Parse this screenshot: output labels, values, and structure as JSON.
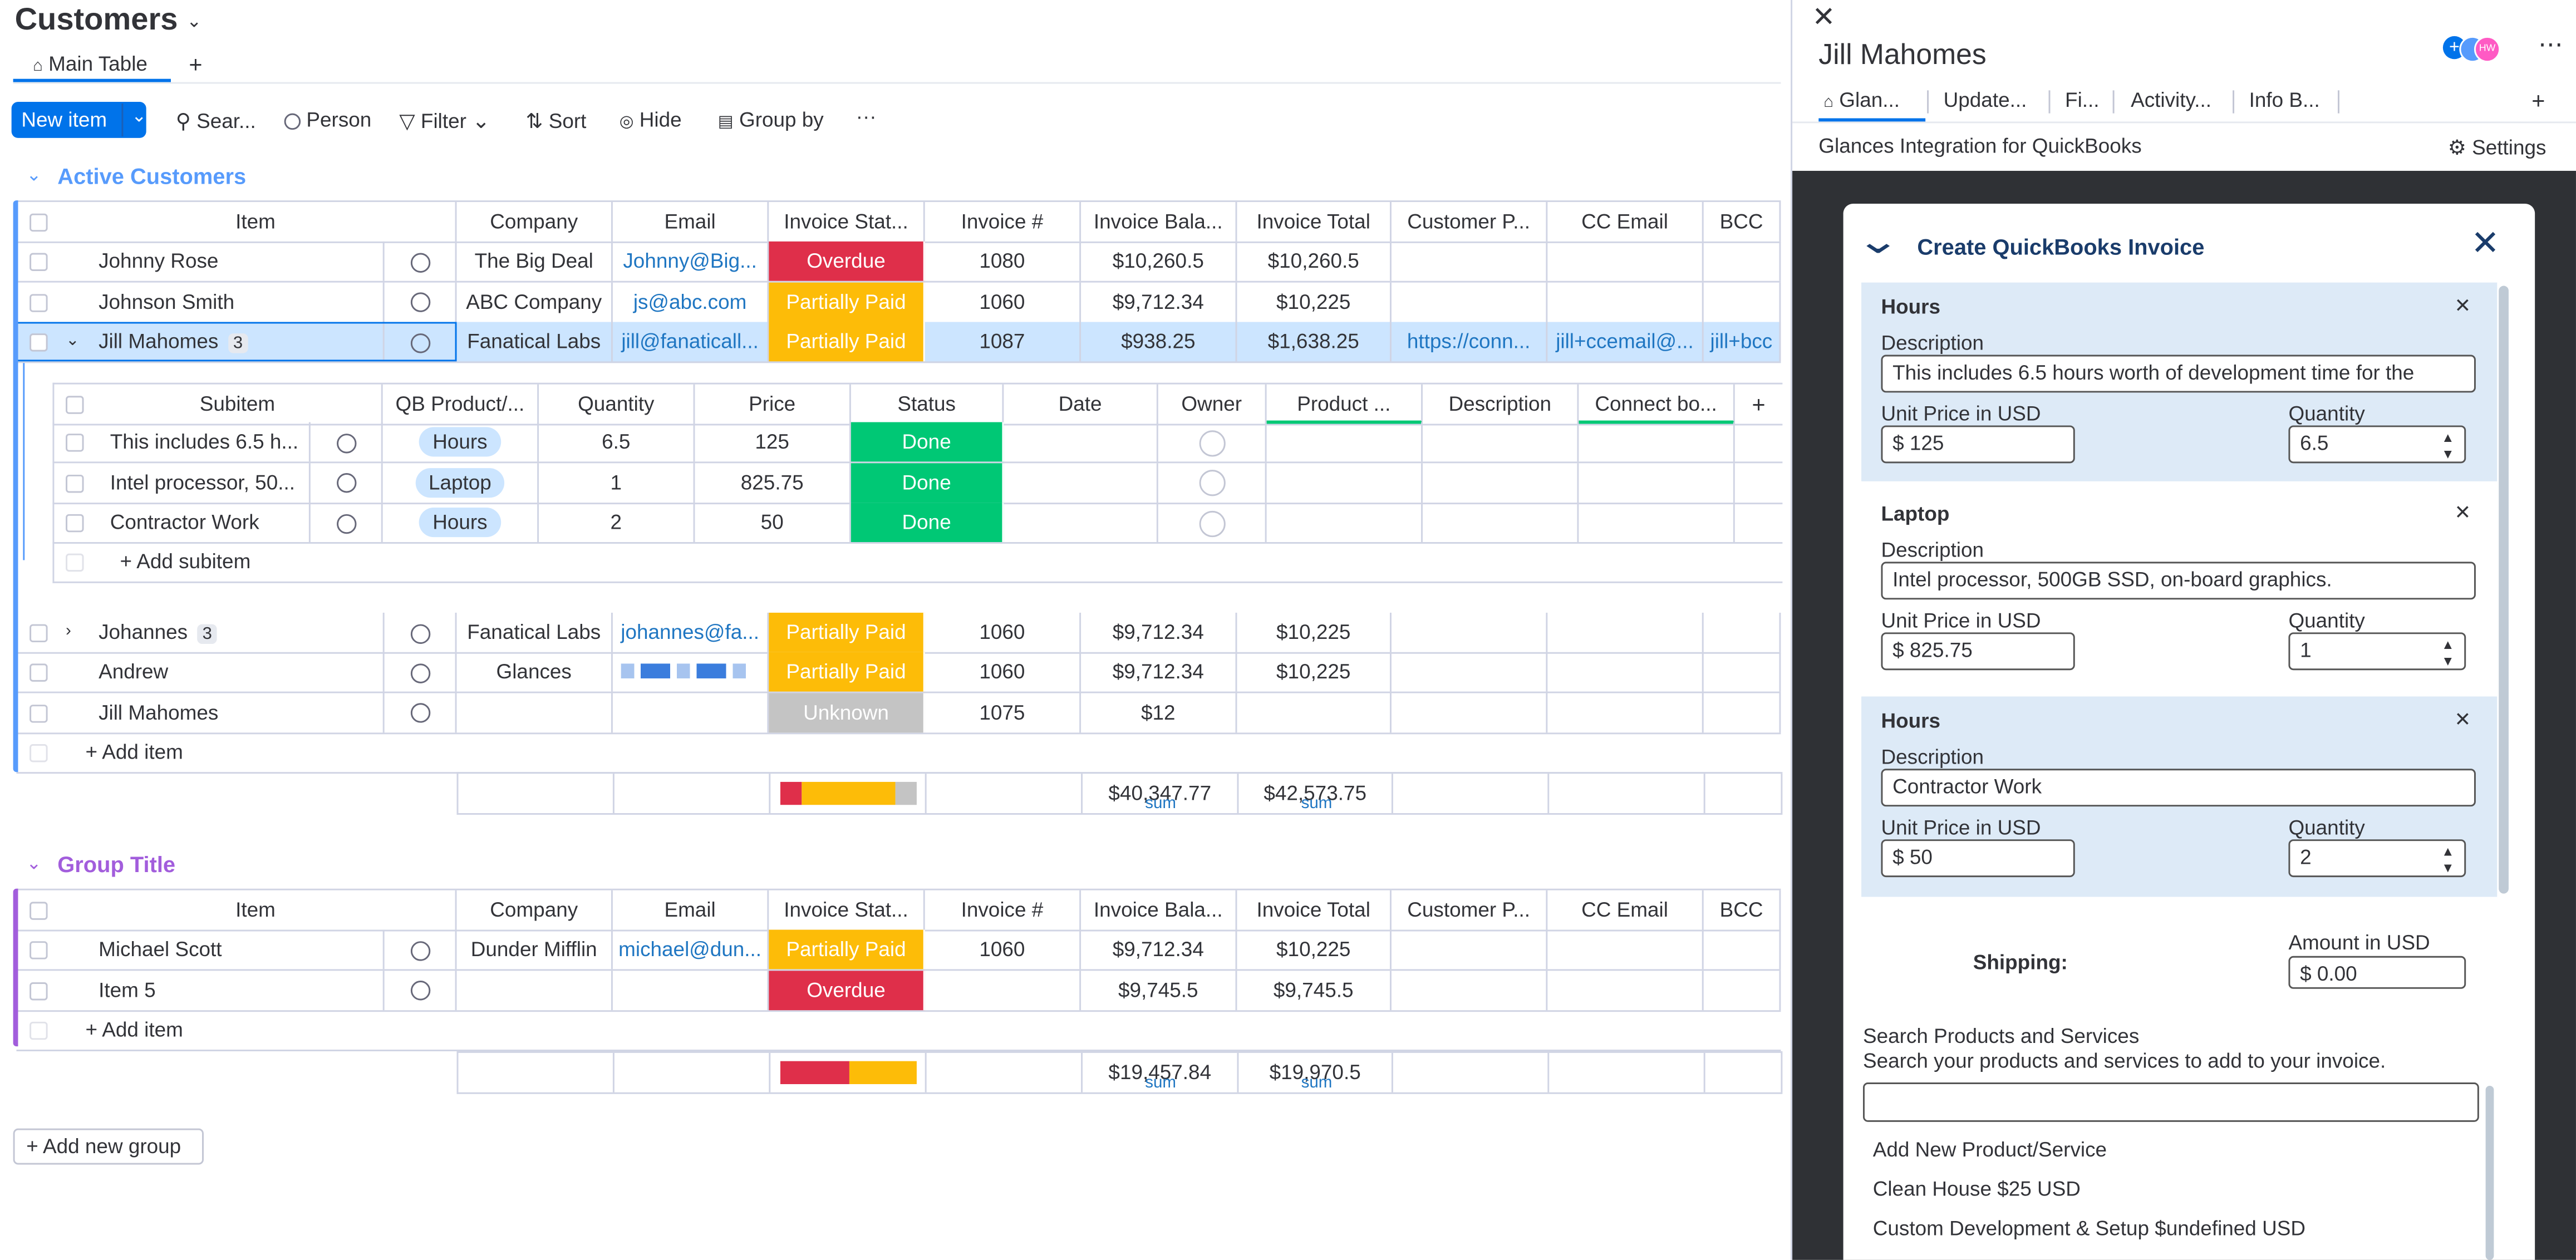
{
  "board": {
    "title": "Customers",
    "views": [
      "Main Table"
    ],
    "add_view": "+",
    "toolbar": {
      "new_item": "New item",
      "search": "Sear...",
      "person": "Person",
      "filter": "Filter",
      "sort": "Sort",
      "hide": "Hide",
      "group_by": "Group by",
      "more": "···"
    }
  },
  "columns": [
    "Item",
    "Company",
    "Email",
    "Invoice Stat...",
    "Invoice #",
    "Invoice Bala...",
    "Invoice Total",
    "Customer P...",
    "CC Email",
    "BCC"
  ],
  "groups": [
    {
      "title": "Active Customers",
      "color": "#579bfc",
      "rows": [
        {
          "item": "Johnny Rose",
          "company": "The Big Deal",
          "email": "Johnny@Big...",
          "status": "Overdue",
          "invoice": "1080",
          "balance": "$10,260.5",
          "total": "$10,260.5",
          "portal": "",
          "cc": "",
          "bcc": ""
        },
        {
          "item": "Johnson Smith",
          "company": "ABC Company",
          "email": "js@abc.com",
          "status": "Partially Paid",
          "invoice": "1060",
          "balance": "$9,712.34",
          "total": "$10,225",
          "portal": "",
          "cc": "",
          "bcc": ""
        },
        {
          "item": "Jill Mahomes",
          "sub_count": "3",
          "company": "Fanatical Labs",
          "email": "jill@fanaticall...",
          "status": "Partially Paid",
          "invoice": "1087",
          "balance": "$938.25",
          "total": "$1,638.25",
          "portal": "https://conn...",
          "cc": "jill+ccemail@...",
          "bcc": "jill+bcc"
        }
      ],
      "subitems": {
        "columns": [
          "Subitem",
          "QB Product/...",
          "Quantity",
          "Price",
          "Status",
          "Date",
          "Owner",
          "Product ...",
          "Description",
          "Connect bo..."
        ],
        "rows": [
          {
            "name": "This includes 6.5 h...",
            "product": "Hours",
            "qty": "6.5",
            "price": "125",
            "status": "Done"
          },
          {
            "name": "Intel processor, 50...",
            "product": "Laptop",
            "qty": "1",
            "price": "825.75",
            "status": "Done"
          },
          {
            "name": "Contractor Work",
            "product": "Hours",
            "qty": "2",
            "price": "50",
            "status": "Done"
          }
        ],
        "add_label": "+ Add subitem"
      },
      "rows_after": [
        {
          "item": "Johannes",
          "sub_count": "3",
          "company": "Fanatical Labs",
          "email": "johannes@fa...",
          "status": "Partially Paid",
          "invoice": "1060",
          "balance": "$9,712.34",
          "total": "$10,225"
        },
        {
          "item": "Andrew",
          "company": "Glances",
          "email": "",
          "status": "Partially Paid",
          "invoice": "1060",
          "balance": "$9,712.34",
          "total": "$10,225"
        },
        {
          "item": "Jill Mahomes",
          "company": "",
          "email": "",
          "status": "Unknown",
          "invoice": "1075",
          "balance": "$12",
          "total": ""
        }
      ],
      "add_item": "+ Add item",
      "summary": {
        "balance": "$40,347.77",
        "total": "$42,573.75",
        "sum_label": "sum",
        "status_bar": [
          {
            "color": "#df2f4a",
            "frac": 0.16
          },
          {
            "color": "#fdbc08",
            "frac": 0.68
          },
          {
            "color": "#c4c4c4",
            "frac": 0.16
          }
        ]
      }
    },
    {
      "title": "Group Title",
      "color": "#a25ddc",
      "rows": [
        {
          "item": "Michael Scott",
          "company": "Dunder Mifflin",
          "email": "michael@dun...",
          "status": "Partially Paid",
          "invoice": "1060",
          "balance": "$9,712.34",
          "total": "$10,225"
        },
        {
          "item": "Item 5",
          "company": "",
          "email": "",
          "status": "Overdue",
          "invoice": "",
          "balance": "$9,745.5",
          "total": "$9,745.5"
        }
      ],
      "add_item": "+ Add item",
      "summary": {
        "balance": "$19,457.84",
        "total": "$19,970.5",
        "sum_label": "sum",
        "status_bar": [
          {
            "color": "#df2f4a",
            "frac": 0.5
          },
          {
            "color": "#fdbc08",
            "frac": 0.5
          }
        ]
      }
    }
  ],
  "add_group": "Add new group",
  "panel": {
    "title": "Jill Mahomes",
    "avatar_initials": "HW",
    "tabs": [
      "Glan...",
      "Update...",
      "Fi...",
      "Activity...",
      "Info B..."
    ],
    "add_tab": "+",
    "integration_title": "Glances Integration for QuickBooks",
    "settings": "Settings",
    "form": {
      "title": "Create QuickBooks Invoice",
      "items": [
        {
          "name": "Hours",
          "description_label": "Description",
          "description": "This includes 6.5 hours worth of development time for the",
          "price_label": "Unit Price in USD",
          "price": "$ 125",
          "qty_label": "Quantity",
          "qty": "6.5"
        },
        {
          "name": "Laptop",
          "description_label": "Description",
          "description": "Intel processor, 500GB SSD, on-board graphics.",
          "price_label": "Unit Price in USD",
          "price": "$ 825.75",
          "qty_label": "Quantity",
          "qty": "1"
        },
        {
          "name": "Hours",
          "description_label": "Description",
          "description": "Contractor Work",
          "price_label": "Unit Price in USD",
          "price": "$ 50",
          "qty_label": "Quantity",
          "qty": "2"
        }
      ],
      "shipping_label": "Shipping:",
      "amount_label": "Amount in USD",
      "amount": "$ 0.00",
      "search_title": "Search Products and Services",
      "search_hint": "Search your products and services to add to your invoice.",
      "search_value": "",
      "products": [
        "Add New Product/Service",
        "Clean House $25 USD",
        "Custom Development & Setup $undefined USD"
      ]
    }
  },
  "colors": {
    "accent": "#0073ea",
    "overdue": "#df2f4a",
    "partial": "#fdbc08",
    "done": "#00c875",
    "unknown": "#c4c4c4"
  }
}
